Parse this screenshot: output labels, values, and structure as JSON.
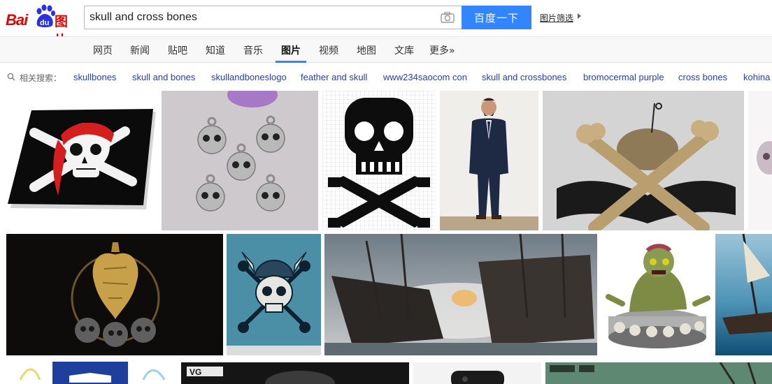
{
  "header": {
    "logo": {
      "bai": "Bai",
      "du": "du",
      "pic": "图片"
    },
    "search_query": "skull and cross bones",
    "search_button": "百度一下",
    "filter_link": "图片筛选"
  },
  "nav": {
    "items": [
      "网页",
      "新闻",
      "贴吧",
      "知道",
      "音乐",
      "图片",
      "视频",
      "地图",
      "文库",
      "更多»"
    ],
    "active_index": 5
  },
  "related": {
    "label": "相关搜索：",
    "items": [
      "skullbones",
      "skull and bones",
      "skullandboneslogo",
      "feather and skull",
      "www234saocom con",
      "skull and crossbones",
      "bromocermal purple",
      "cross bones",
      "kohina"
    ]
  },
  "images": {
    "row1": [
      "pirate flag skull",
      "skull charms",
      "skull cross-stitch pattern",
      "man in suit",
      "crossed bones on black",
      "partial image"
    ],
    "row2": [
      "golden heart skull",
      "viking skull illustration",
      "pirate ships battle",
      "zombie figurine",
      "ship at sea"
    ],
    "row3": [
      "book emblem",
      "video thumbnail",
      "phone case",
      "game scene"
    ],
    "watermark_text": "VG"
  },
  "colors": {
    "brand_red": "#e10601",
    "brand_blue": "#3385ff",
    "link": "#2440b3"
  }
}
